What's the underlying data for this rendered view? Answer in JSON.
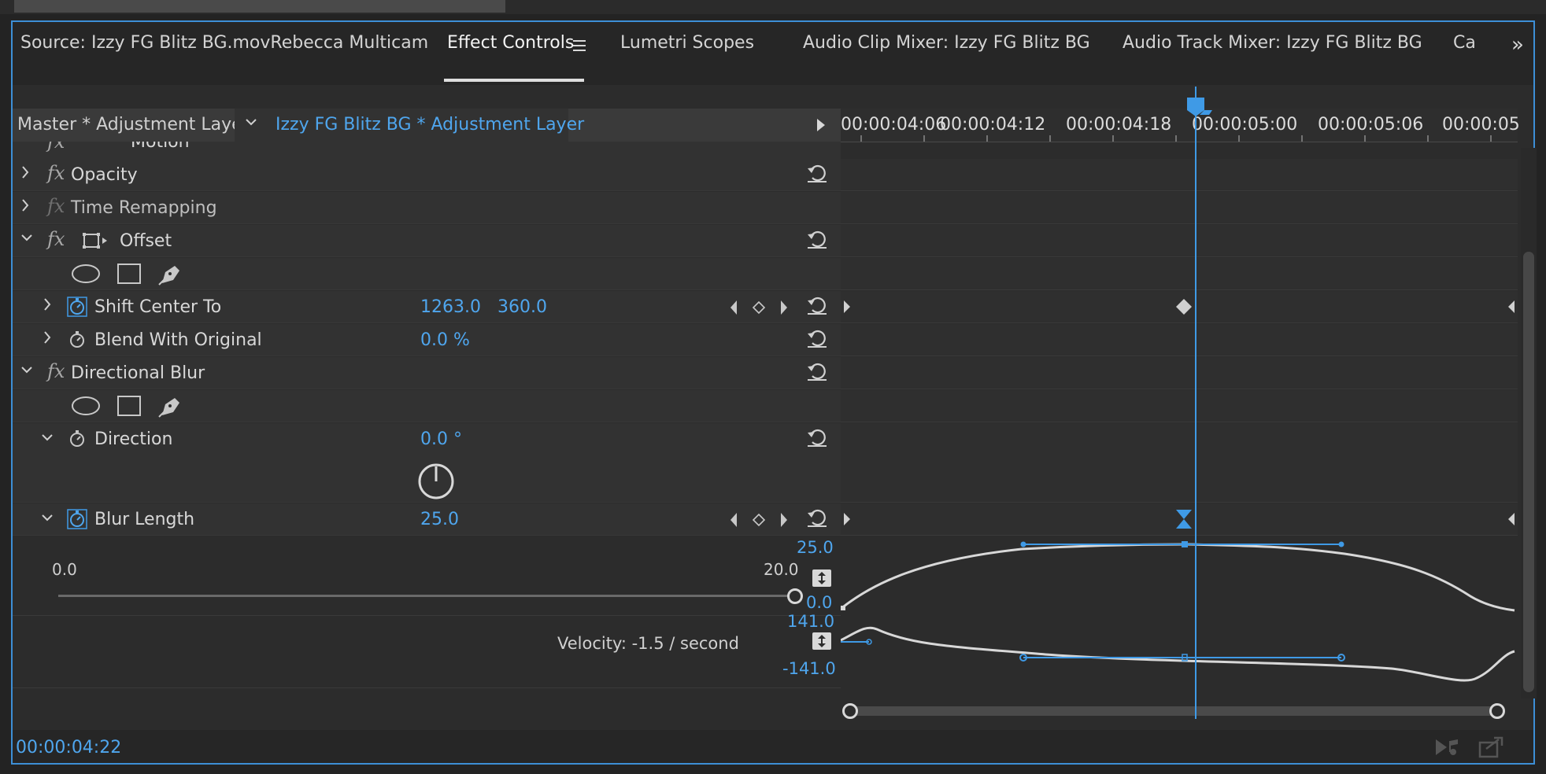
{
  "tabs": [
    {
      "label": "Source: Izzy FG Blitz BG.movRebecca Multicam"
    },
    {
      "label": "Effect Controls"
    },
    {
      "label": "Lumetri Scopes"
    },
    {
      "label": "Audio Clip Mixer: Izzy FG Blitz BG"
    },
    {
      "label": "Audio Track Mixer: Izzy FG Blitz BG"
    },
    {
      "label": "Ca"
    }
  ],
  "clip": {
    "master": "Master * Adjustment Layer",
    "current": "Izzy FG Blitz BG * Adjustment Layer"
  },
  "ruler": [
    "00:00:04:06",
    "00:00:04:12",
    "00:00:04:18",
    "00:00:05:00",
    "00:00:05:06",
    "00:00:05"
  ],
  "effects": {
    "motion": "Motion",
    "opacity": "Opacity",
    "time_remapping": "Time Remapping",
    "offset": "Offset",
    "shift_center": {
      "label": "Shift Center To",
      "x": "1263.0",
      "y": "360.0"
    },
    "blend": {
      "label": "Blend With Original",
      "value": "0.0 %"
    },
    "directional_blur": "Directional Blur",
    "direction": {
      "label": "Direction",
      "value": "0.0 °"
    },
    "blur_length": {
      "label": "Blur Length",
      "value": "25.0"
    }
  },
  "slider": {
    "min": "0.0",
    "max": "20.0"
  },
  "graph": {
    "value_top": "25.0",
    "value_bottom": "0.0",
    "velocity_top": "141.0",
    "velocity_bottom": "-141.0",
    "velocity_text": "Velocity: -1.5 / second"
  },
  "timecode": "00:00:04:22",
  "colors": {
    "accent": "#3f9ae6",
    "panel_border": "#3d8fd6"
  }
}
